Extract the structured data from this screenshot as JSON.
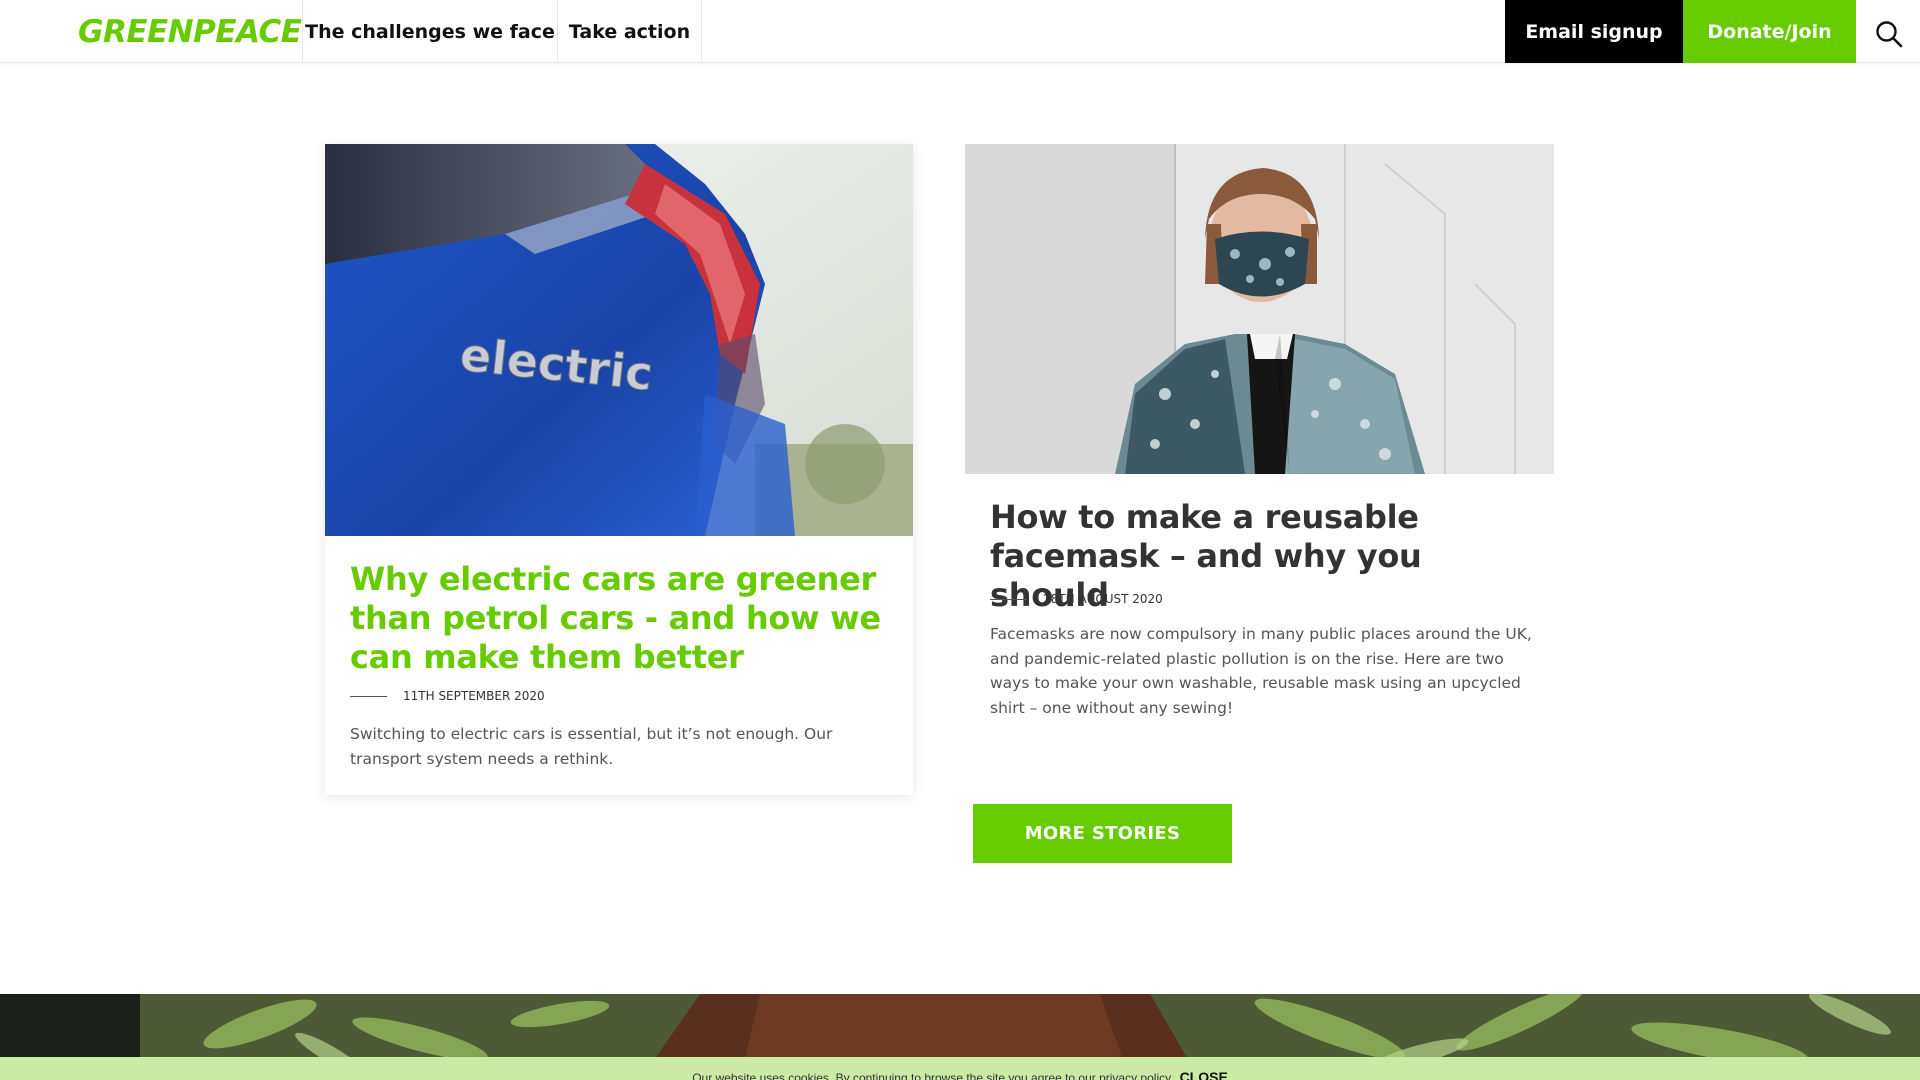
{
  "header": {
    "logo_text": "GREENPEACE",
    "nav": [
      {
        "label": "The challenges we face"
      },
      {
        "label": "Take action"
      }
    ],
    "email_signup_label": "Email signup",
    "donate_label": "Donate/Join",
    "search_icon": "search-icon"
  },
  "articles": [
    {
      "title": "Why electric cars are greener than petrol cars - and how we can make them better",
      "date": "11TH SEPTEMBER 2020",
      "excerpt": "Switching to electric cars is essential, but it’s not enough. Our transport system needs a rethink.",
      "image_text": "electric"
    },
    {
      "title": "How to make a reusable facemask – and why you should",
      "date": "28TH AUGUST 2020",
      "excerpt": "Facemasks are now compulsory in many public places around the UK, and pandemic-related plastic pollution is on the rise. Here are two ways to make your own washable, reusable mask using an upcycled shirt – one without any sewing!"
    }
  ],
  "more_stories_label": "MORE STORIES",
  "cookie_bar": {
    "message": "Our website uses cookies. By continuing to browse the site you agree to our privacy policy.",
    "close_label": "CLOSE"
  },
  "colors": {
    "brand_green": "#66cc00",
    "signup_black": "#000000",
    "cookie_bg": "#cbeaa5"
  }
}
